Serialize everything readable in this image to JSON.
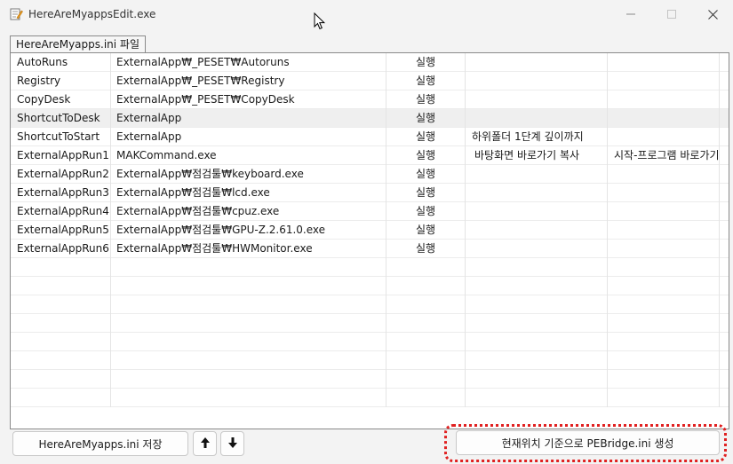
{
  "window": {
    "title": "HereAreMyappsEdit.exe",
    "controls": {
      "minimize": "minimize-icon",
      "maximize": "maximize-icon",
      "close": "close-icon"
    }
  },
  "tab": {
    "label": "HereAreMyapps.ini 파일"
  },
  "rows": [
    [
      "AutoRuns",
      "ExternalApp₩_PESET₩Autoruns",
      "실행",
      "",
      ""
    ],
    [
      "Registry",
      "ExternalApp₩_PESET₩Registry",
      "실행",
      "",
      ""
    ],
    [
      "CopyDesk",
      "ExternalApp₩_PESET₩CopyDesk",
      "실행",
      "",
      ""
    ],
    [
      "ShortcutToDesk",
      "ExternalApp",
      "실행",
      "",
      ""
    ],
    [
      "ShortcutToStart",
      "ExternalApp",
      "실행",
      "하위폴더 1단계 깊이까지",
      ""
    ],
    [
      "ExternalAppRun1",
      "MAKCommand.exe",
      "실행",
      "바탕화면 바로가기 복사",
      "시작-프로그램 바로가기"
    ],
    [
      "ExternalAppRun2",
      "ExternalApp₩점검툴₩keyboard.exe",
      "실행",
      "",
      ""
    ],
    [
      "ExternalAppRun3",
      "ExternalApp₩점검툴₩lcd.exe",
      "실행",
      "",
      ""
    ],
    [
      "ExternalAppRun4",
      "ExternalApp₩점검툴₩cpuz.exe",
      "실행",
      "",
      ""
    ],
    [
      "ExternalAppRun5",
      "ExternalApp₩점검툴₩GPU-Z.2.61.0.exe",
      "실행",
      "",
      ""
    ],
    [
      "ExternalAppRun6",
      "ExternalApp₩점검툴₩HWMonitor.exe",
      "실행",
      "",
      ""
    ]
  ],
  "selected_row": 3,
  "empty_rows": 8,
  "buttons": {
    "save": "HereAreMyapps.ini 저장",
    "move_up": "arrow-up-icon",
    "move_down": "arrow-down-icon",
    "generate": "현재위치 기준으로 PEBridge.ini 생성"
  },
  "colors": {
    "highlight": "#e02020",
    "selection": "#efefef"
  }
}
